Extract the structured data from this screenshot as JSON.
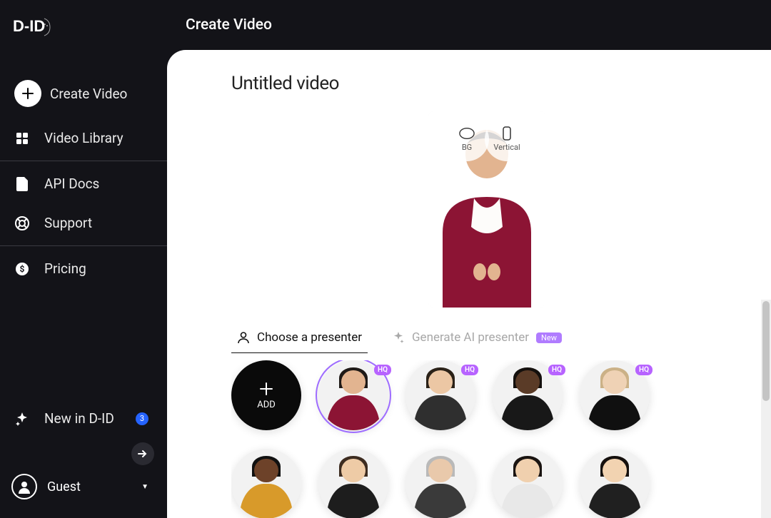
{
  "app": {
    "brand": "D-ID"
  },
  "sidebar": {
    "items": [
      {
        "label": "Create Video"
      },
      {
        "label": "Video Library"
      },
      {
        "label": "API Docs"
      },
      {
        "label": "Support"
      },
      {
        "label": "Pricing"
      },
      {
        "label": "New in D-ID",
        "badge": "3"
      }
    ],
    "user_label": "Guest"
  },
  "header": {
    "title": "Create Video"
  },
  "video": {
    "title": "Untitled video"
  },
  "preview": {
    "bg_chip": "BG",
    "orientation_chip": "Vertical"
  },
  "tabs": {
    "choose": "Choose a presenter",
    "generate": "Generate AI presenter",
    "new_badge": "New"
  },
  "presenters": {
    "add_label": "ADD",
    "hq_label": "HQ",
    "row1": [
      {
        "hq": true,
        "selected": true,
        "skin": "#e2b490",
        "hair": "#1f1a17",
        "body": "#8c1434"
      },
      {
        "hq": true,
        "skin": "#ecc7a4",
        "hair": "#2b2218",
        "body": "#2f2f2f"
      },
      {
        "hq": true,
        "skin": "#5a3b27",
        "hair": "#14100d",
        "body": "#181818"
      },
      {
        "hq": true,
        "skin": "#efd2b5",
        "hair": "#cbb187",
        "body": "#101010"
      }
    ],
    "row2": [
      {
        "skin": "#6d4229",
        "hair": "#111",
        "body": "#d89a2a"
      },
      {
        "skin": "#eecba6",
        "hair": "#3d2c20",
        "body": "#1d1d1d"
      },
      {
        "skin": "#e9c9ab",
        "hair": "#b9b9b9",
        "body": "#3a3a3a"
      },
      {
        "skin": "#f0d0ae",
        "hair": "#1a1411",
        "body": "#e8e8e8"
      },
      {
        "skin": "#f2d3b1",
        "hair": "#15100d",
        "body": "#202020"
      }
    ]
  },
  "colors": {
    "accent": "#9e6cff",
    "hq": "#b763ff"
  }
}
